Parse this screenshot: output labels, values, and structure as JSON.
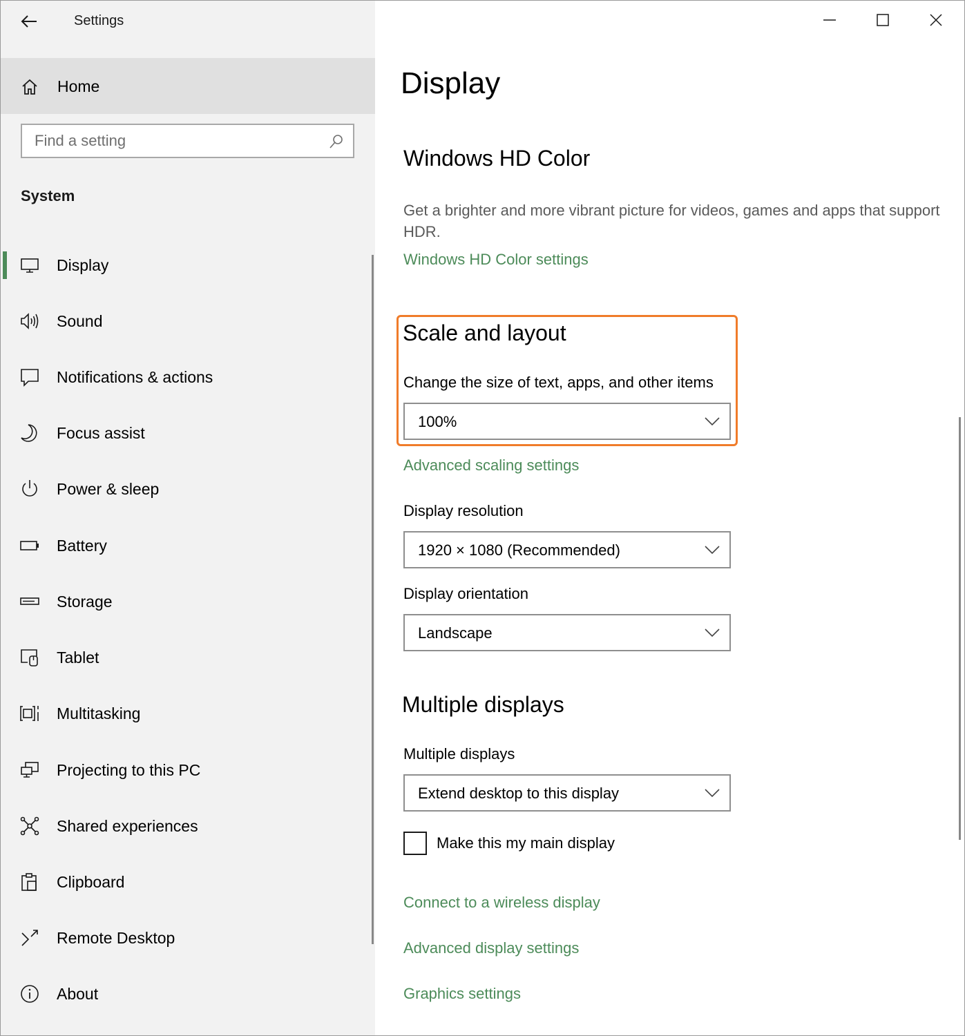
{
  "window": {
    "title": "Settings",
    "controls": {
      "minimize": "minimize-icon",
      "maximize": "maximize-icon",
      "close": "close-icon"
    }
  },
  "sidebar": {
    "home_label": "Home",
    "search": {
      "placeholder": "Find a setting",
      "value": ""
    },
    "section_label": "System",
    "items": [
      {
        "label": "Display",
        "icon": "display-icon",
        "selected": true
      },
      {
        "label": "Sound",
        "icon": "speaker-icon"
      },
      {
        "label": "Notifications & actions",
        "icon": "notifications-icon"
      },
      {
        "label": "Focus assist",
        "icon": "moon-icon"
      },
      {
        "label": "Power & sleep",
        "icon": "power-icon"
      },
      {
        "label": "Battery",
        "icon": "battery-icon"
      },
      {
        "label": "Storage",
        "icon": "storage-icon"
      },
      {
        "label": "Tablet",
        "icon": "tablet-icon"
      },
      {
        "label": "Multitasking",
        "icon": "multitasking-icon"
      },
      {
        "label": "Projecting to this PC",
        "icon": "projecting-icon"
      },
      {
        "label": "Shared experiences",
        "icon": "shared-experiences-icon"
      },
      {
        "label": "Clipboard",
        "icon": "clipboard-icon"
      },
      {
        "label": "Remote Desktop",
        "icon": "remote-desktop-icon"
      },
      {
        "label": "About",
        "icon": "info-icon"
      }
    ]
  },
  "main": {
    "page_title": "Display",
    "hd_color": {
      "heading": "Windows HD Color",
      "description": "Get a brighter and more vibrant picture for videos, games and apps that support HDR.",
      "link": "Windows HD Color settings"
    },
    "scale_layout": {
      "heading": "Scale and layout",
      "scale_label": "Change the size of text, apps, and other items",
      "scale_value": "100%",
      "advanced_link": "Advanced scaling settings",
      "resolution_label": "Display resolution",
      "resolution_value": "1920 × 1080 (Recommended)",
      "orientation_label": "Display orientation",
      "orientation_value": "Landscape"
    },
    "multiple_displays": {
      "heading": "Multiple displays",
      "label": "Multiple displays",
      "value": "Extend desktop to this display",
      "checkbox_label": "Make this my main display",
      "checkbox_checked": false,
      "links": [
        "Connect to a wireless display",
        "Advanced display settings",
        "Graphics settings"
      ]
    }
  },
  "colors": {
    "accent": "#4c8b59",
    "highlight": "#f07c2a",
    "sidebar_bg": "#f2f2f2",
    "home_bg": "#e0e0e0"
  }
}
